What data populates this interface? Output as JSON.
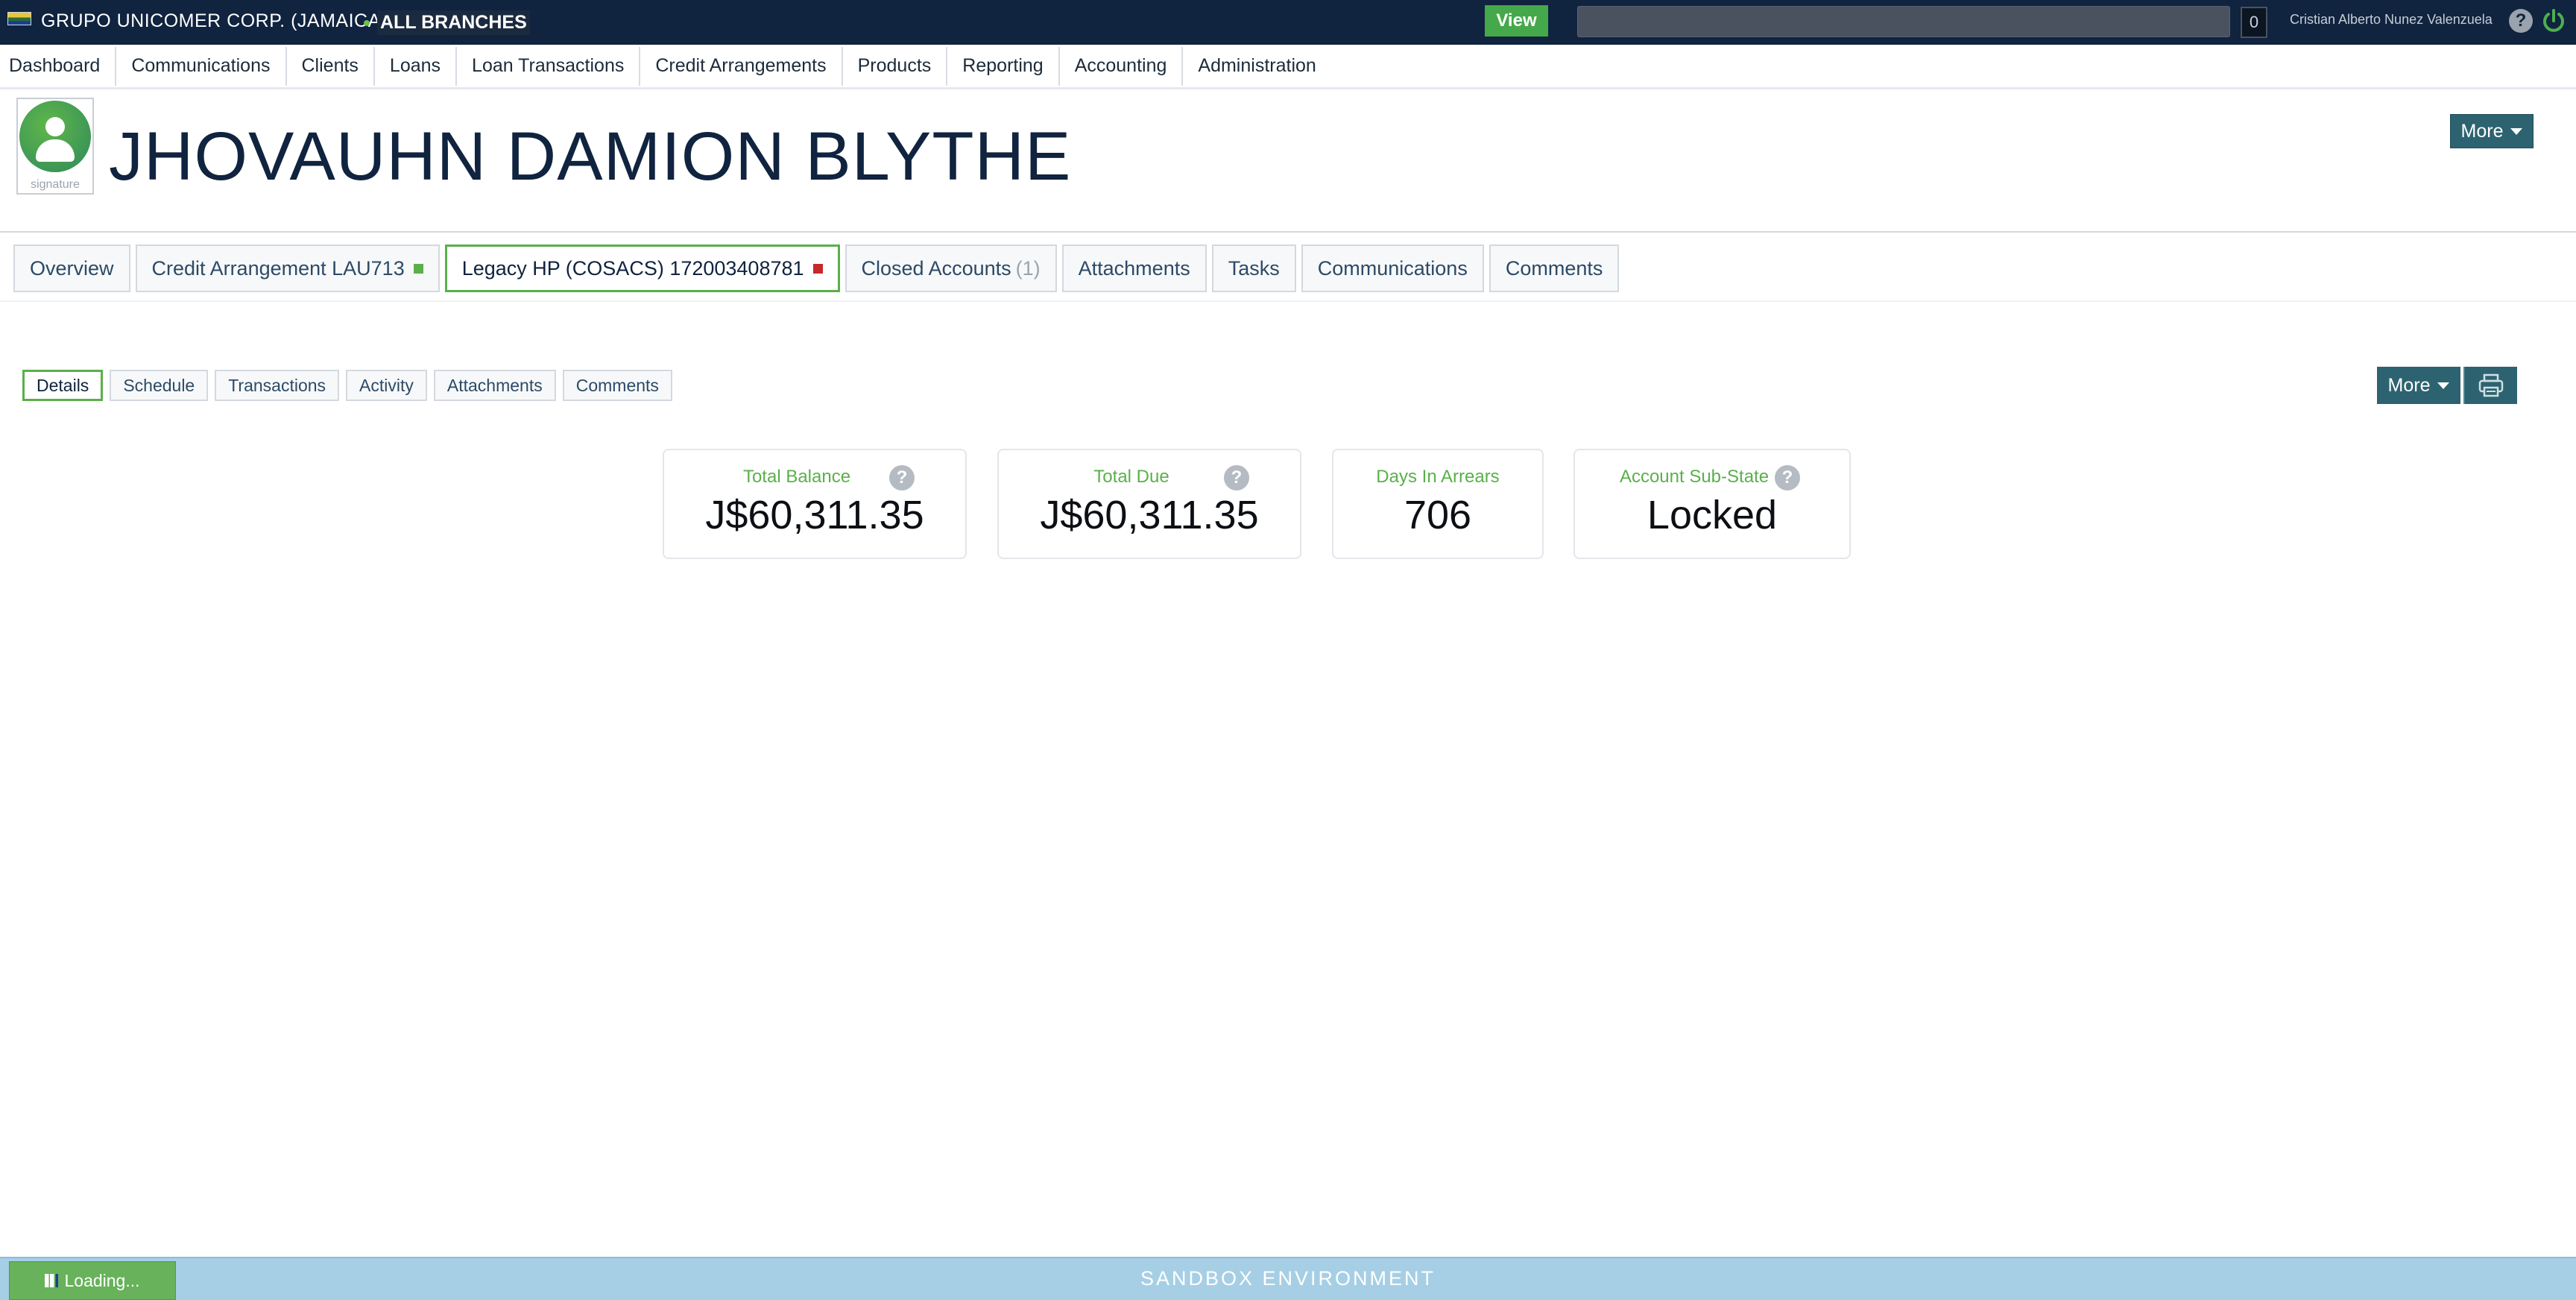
{
  "topbar": {
    "org_name": "GRUPO UNICOMER CORP. (JAMAICA)",
    "branch": "ALL BRANCHES",
    "view_label": "View",
    "search_value": "",
    "counter": "0",
    "user_name": "Cristian Alberto Nunez Valenzuela",
    "help_icon": "?"
  },
  "main_nav": {
    "items": [
      "Dashboard",
      "Communications",
      "Clients",
      "Loans",
      "Loan Transactions",
      "Credit Arrangements",
      "Products",
      "Reporting",
      "Accounting",
      "Administration"
    ]
  },
  "client": {
    "name": "JHOVAUHN DAMION BLYTHE",
    "avatar_caption": "signature",
    "more_label": "More"
  },
  "tabs": {
    "overview": "Overview",
    "credit_arrangement": "Credit Arrangement LAU713",
    "legacy_hp": "Legacy HP (COSACS) 172003408781",
    "closed_accounts": "Closed Accounts",
    "closed_count": "(1)",
    "attachments": "Attachments",
    "tasks": "Tasks",
    "communications": "Communications",
    "comments": "Comments"
  },
  "subtabs": {
    "items": [
      "Details",
      "Schedule",
      "Transactions",
      "Activity",
      "Attachments",
      "Comments"
    ],
    "active": "Details",
    "more_label": "More"
  },
  "stats": {
    "total_balance": {
      "label": "Total Balance",
      "value": "J$60,311.35"
    },
    "total_due": {
      "label": "Total Due",
      "value": "J$60,311.35"
    },
    "days_in_arrears": {
      "label": "Days In Arrears",
      "value": "706"
    },
    "account_sub_state": {
      "label": "Account Sub-State",
      "value": "Locked"
    }
  },
  "footer": {
    "environment": "SANDBOX ENVIRONMENT",
    "loading": "Loading..."
  },
  "colors": {
    "topbar": "#10233f",
    "accent_green": "#5ab04a",
    "teal_button": "#2d6370",
    "footer": "#a6cfe5",
    "status_active": "#5ab04a",
    "status_closed": "#c6282b"
  }
}
